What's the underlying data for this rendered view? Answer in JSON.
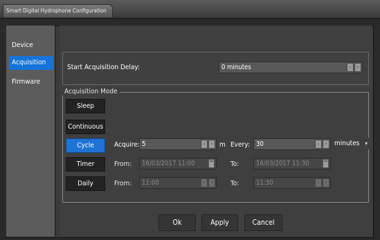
{
  "window": {
    "title": "Smart Digital Hydrophone Configuration"
  },
  "sidebar": {
    "items": [
      {
        "label": "Device",
        "active": false
      },
      {
        "label": "Acquisition",
        "active": true
      },
      {
        "label": "Firmware",
        "active": false
      }
    ]
  },
  "delay": {
    "label": "Start Acquisition Delay:",
    "value": "0 minutes"
  },
  "acquisition_mode": {
    "title": "Acquisition Mode",
    "modes": [
      "Sleep",
      "Continuous",
      "Cycle",
      "Timer",
      "Daily"
    ],
    "selected": "Cycle",
    "cycle": {
      "acquire_label": "Acquire:",
      "acquire_value": "5",
      "acquire_unit": "m",
      "every_label": "Every:",
      "every_value": "30",
      "every_unit": "minutes"
    },
    "timer": {
      "from_label": "From:",
      "from_value": "16/03/2017 11:00",
      "to_label": "To:",
      "to_value": "16/03/2017 11:30"
    },
    "daily": {
      "from_label": "From:",
      "from_value": "11:00",
      "to_label": "To:",
      "to_value": "11:30"
    }
  },
  "buttons": {
    "ok": "Ok",
    "apply": "Apply",
    "cancel": "Cancel"
  },
  "colors": {
    "accent": "#1673d8",
    "background": "#3f3f3f",
    "sidebar": "#5c5c5c"
  },
  "icons": {
    "spin": "spin-up-down-icon",
    "calendar": "calendar-icon",
    "dropdown": "chevron-down-icon"
  }
}
